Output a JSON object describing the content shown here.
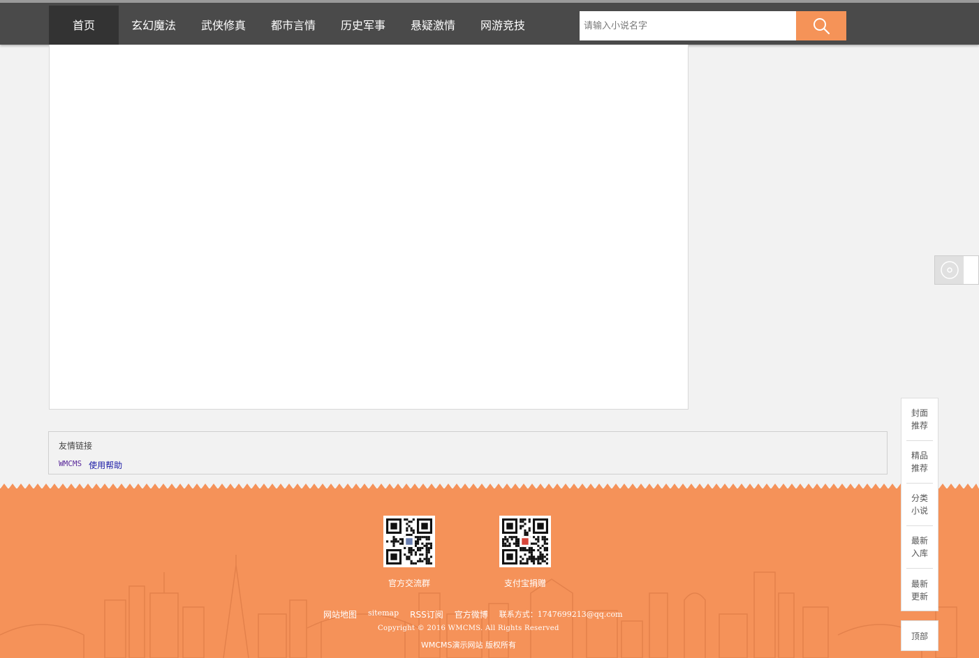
{
  "nav": {
    "items": [
      "首页",
      "玄幻魔法",
      "武侠修真",
      "都市言情",
      "历史军事",
      "悬疑激情",
      "网游竞技"
    ],
    "active": "首页"
  },
  "search": {
    "placeholder": "请输入小说名字",
    "button_icon": "search-icon"
  },
  "links": {
    "title": "友情链接",
    "items": [
      "WMCMS",
      "使用帮助"
    ]
  },
  "footer": {
    "qr": [
      {
        "label": "官方交流群",
        "icon": "qr-code-icon"
      },
      {
        "label": "支付宝捐赠",
        "icon": "qr-code-icon"
      }
    ],
    "nav_links": [
      "网站地图",
      "sitemap",
      "RSS订阅",
      "官方微博",
      "联系方式：1747699213@qq.com"
    ],
    "copyright": "Copyright © 2016 WMCMS. All Rights Reserved",
    "site": "WMCMS演示网站 版权所有"
  },
  "side_menu": {
    "items": [
      "封面\n推荐",
      "精品\n推荐",
      "分类\n小说",
      "最新\n入库",
      "最新\n更新"
    ],
    "top_label": "顶部"
  },
  "colors": {
    "accent": "#f59358",
    "nav_bg": "#4a4a4a",
    "footer_bg": "#f59259"
  }
}
